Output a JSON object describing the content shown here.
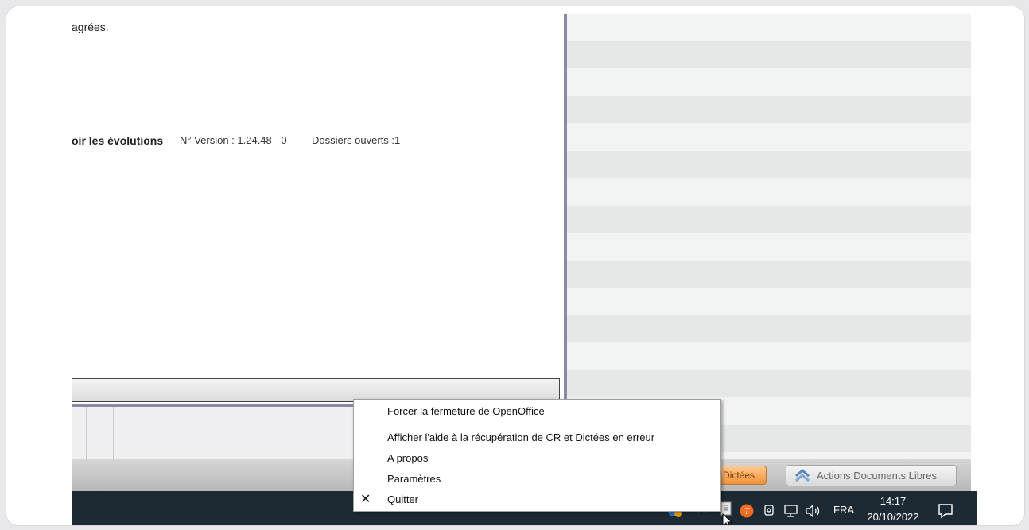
{
  "content": {
    "top_text": "agrées.",
    "evolutions_link": "oir les évolutions",
    "version": "N° Version : 1.24.48 - 0",
    "dossiers": "Dossiers ouverts :1"
  },
  "app_bar": {
    "dictees_label": "Dictées",
    "actions_label": "Actions Documents Libres"
  },
  "context_menu": {
    "items": [
      "Forcer la fermeture de OpenOffice",
      "Afficher l'aide à la récupération de CR et Dictées en erreur",
      "A propos",
      "Paramètres",
      "Quitter"
    ]
  },
  "taskbar": {
    "language": "FRA",
    "time": "14:17",
    "date": "20/10/2022",
    "icons": [
      "chevron-up-icon",
      "app-tray-icon",
      "orange-t-icon",
      "meet-now-icon",
      "network-icon",
      "volume-icon",
      "notification-icon"
    ]
  }
}
